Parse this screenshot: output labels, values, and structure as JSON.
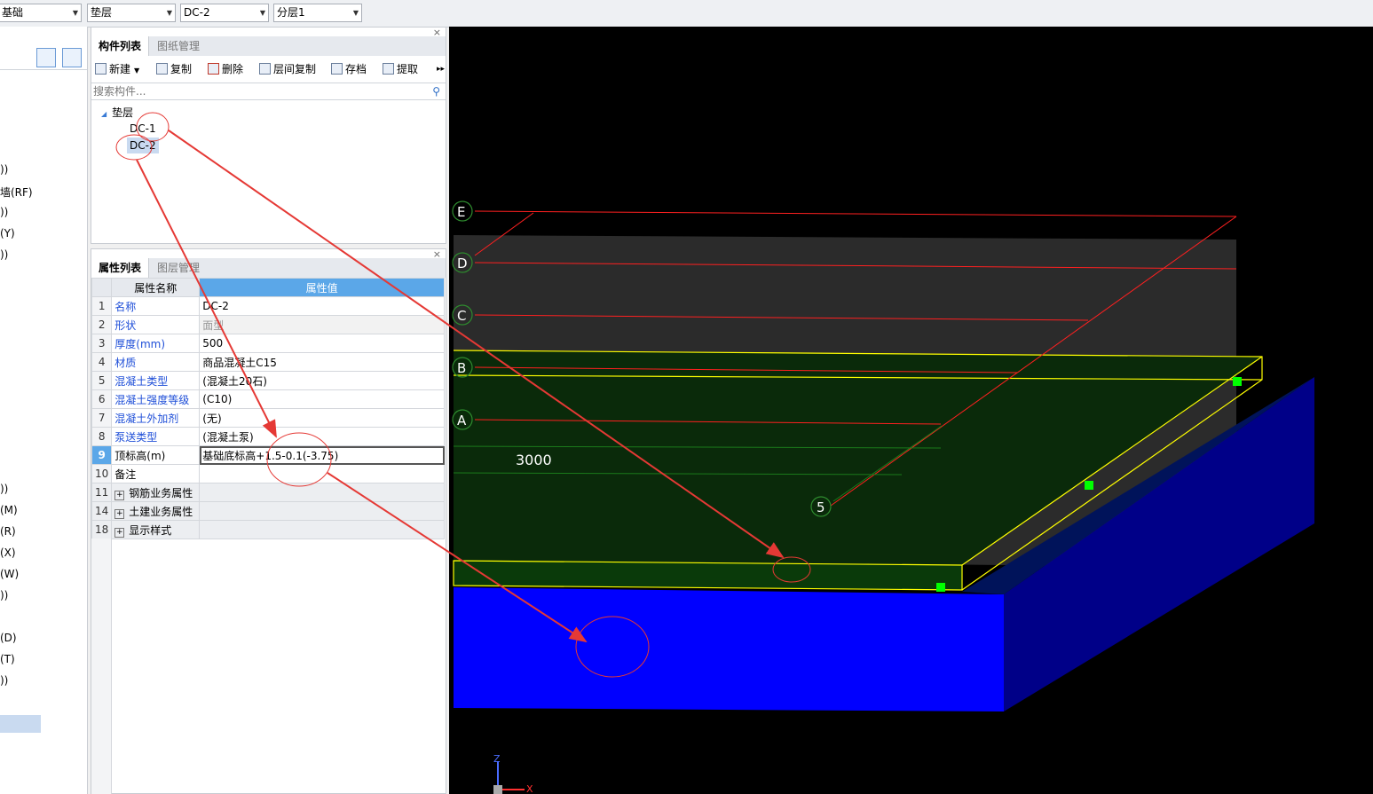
{
  "toolbar": {
    "combos": [
      "基础",
      "垫层",
      "DC-2",
      "分层1"
    ]
  },
  "left_panel": {
    "items": [
      "))",
      "墙(RF)",
      "))",
      "(Y)",
      "))",
      "))",
      "(M)",
      "(R)",
      "(X)",
      "(W)",
      "))",
      "(D)",
      "(T)",
      "))"
    ]
  },
  "component_panel": {
    "tabs": [
      "构件列表",
      "图纸管理"
    ],
    "actions": [
      {
        "label": "新建",
        "icon": "new-icon"
      },
      {
        "label": "复制",
        "icon": "copy-icon"
      },
      {
        "label": "删除",
        "icon": "delete-icon"
      },
      {
        "label": "层间复制",
        "icon": "layer-copy-icon"
      },
      {
        "label": "存档",
        "icon": "archive-icon"
      },
      {
        "label": "提取",
        "icon": "extract-icon"
      }
    ],
    "search_placeholder": "搜索构件...",
    "tree": {
      "root": "垫层",
      "children": [
        "DC-1",
        "DC-2"
      ]
    }
  },
  "property_panel": {
    "tabs": [
      "属性列表",
      "图层管理"
    ],
    "headers": {
      "name": "属性名称",
      "value": "属性值"
    },
    "rows": [
      {
        "num": "1",
        "name": "名称",
        "value": "DC-2"
      },
      {
        "num": "2",
        "name": "形状",
        "value": "面型"
      },
      {
        "num": "3",
        "name": "厚度(mm)",
        "value": "500"
      },
      {
        "num": "4",
        "name": "材质",
        "value": "商品混凝土C15"
      },
      {
        "num": "5",
        "name": "混凝土类型",
        "value": "(混凝土20石)"
      },
      {
        "num": "6",
        "name": "混凝土强度等级",
        "value": "(C10)"
      },
      {
        "num": "7",
        "name": "混凝土外加剂",
        "value": "(无)"
      },
      {
        "num": "8",
        "name": "泵送类型",
        "value": "(混凝土泵)"
      },
      {
        "num": "9",
        "name": "顶标高(m)",
        "value": "基础底标高+1.5-0.1(-3.75)"
      },
      {
        "num": "10",
        "name": "备注",
        "value": ""
      },
      {
        "num": "11",
        "name": "钢筋业务属性",
        "value": ""
      },
      {
        "num": "14",
        "name": "土建业务属性",
        "value": ""
      },
      {
        "num": "18",
        "name": "显示样式",
        "value": ""
      }
    ]
  },
  "viewport": {
    "axis_labels": [
      "E",
      "D",
      "C",
      "B",
      "A",
      "5"
    ],
    "dimension_text": "3000",
    "gizmo": {
      "z": "Z",
      "x": "X"
    }
  },
  "colors": {
    "accent": "#5ba7e8",
    "annotation": "#e53935",
    "slab_outline": "#ffff00",
    "block": "#0000ff"
  }
}
